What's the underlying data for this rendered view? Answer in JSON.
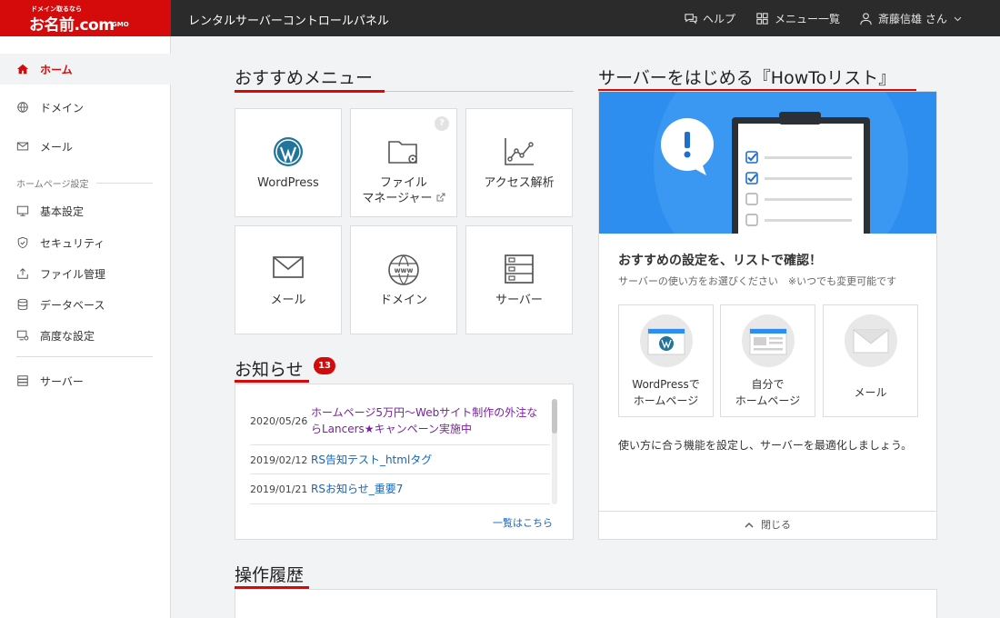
{
  "header": {
    "logo_tagline": "ドメイン取るなら",
    "logo_text": "お名前.com",
    "logo_suffix": "GMO",
    "app_title": "レンタルサーバーコントロールパネル",
    "help_label": "ヘルプ",
    "menu_label": "メニュー一覧",
    "user_label": "斎藤信雄 さん"
  },
  "sidebar": {
    "items": [
      {
        "label": "ホーム"
      },
      {
        "label": "ドメイン"
      },
      {
        "label": "メール"
      }
    ],
    "section_label": "ホームページ設定",
    "settings": [
      {
        "label": "基本設定"
      },
      {
        "label": "セキュリティ"
      },
      {
        "label": "ファイル管理"
      },
      {
        "label": "データベース"
      },
      {
        "label": "高度な設定"
      }
    ],
    "server_label": "サーバー"
  },
  "recommended": {
    "title": "おすすめメニュー",
    "tiles": [
      {
        "label": "WordPress"
      },
      {
        "label": "ファイル",
        "label2": "マネージャー"
      },
      {
        "label": "アクセス解析"
      },
      {
        "label": "メール"
      },
      {
        "label": "ドメイン"
      },
      {
        "label": "サーバー"
      }
    ],
    "help_mark": "?"
  },
  "news": {
    "title": "お知らせ",
    "count": "13",
    "items": [
      {
        "date": "2020/05/26",
        "title_l1": "ホームページ5万円〜Webサイト制作の外注な",
        "title_l2": "らLancers★キャンペーン実施中"
      },
      {
        "date": "2019/02/12",
        "title": "RS告知テスト_htmlタグ"
      },
      {
        "date": "2019/01/21",
        "title": "RSお知らせ_重要7"
      }
    ],
    "more_label": "一覧はこちら"
  },
  "howto": {
    "title": "サーバーをはじめる『HowToリスト』",
    "panel_title": "おすすめの設定を、リストで確認！",
    "panel_sub": "サーバーの使い方をお選びください　※いつでも変更可能です",
    "cards": [
      {
        "line1": "WordPressで",
        "line2": "ホームページ"
      },
      {
        "line1": "自分で",
        "line2": "ホームページ"
      },
      {
        "line1": "メール",
        "line2": ""
      }
    ],
    "desc": "使い方に合う機能を設定し、サーバーを最適化しましょう。",
    "close_label": "閉じる"
  },
  "history": {
    "title": "操作履歴"
  },
  "colors": {
    "brand_red": "#d50b0b",
    "header_dark": "#2b2b2b",
    "hero_blue": "#2d8ef0",
    "link_blue": "#1565c0",
    "visited_purple": "#7b1fa2"
  }
}
